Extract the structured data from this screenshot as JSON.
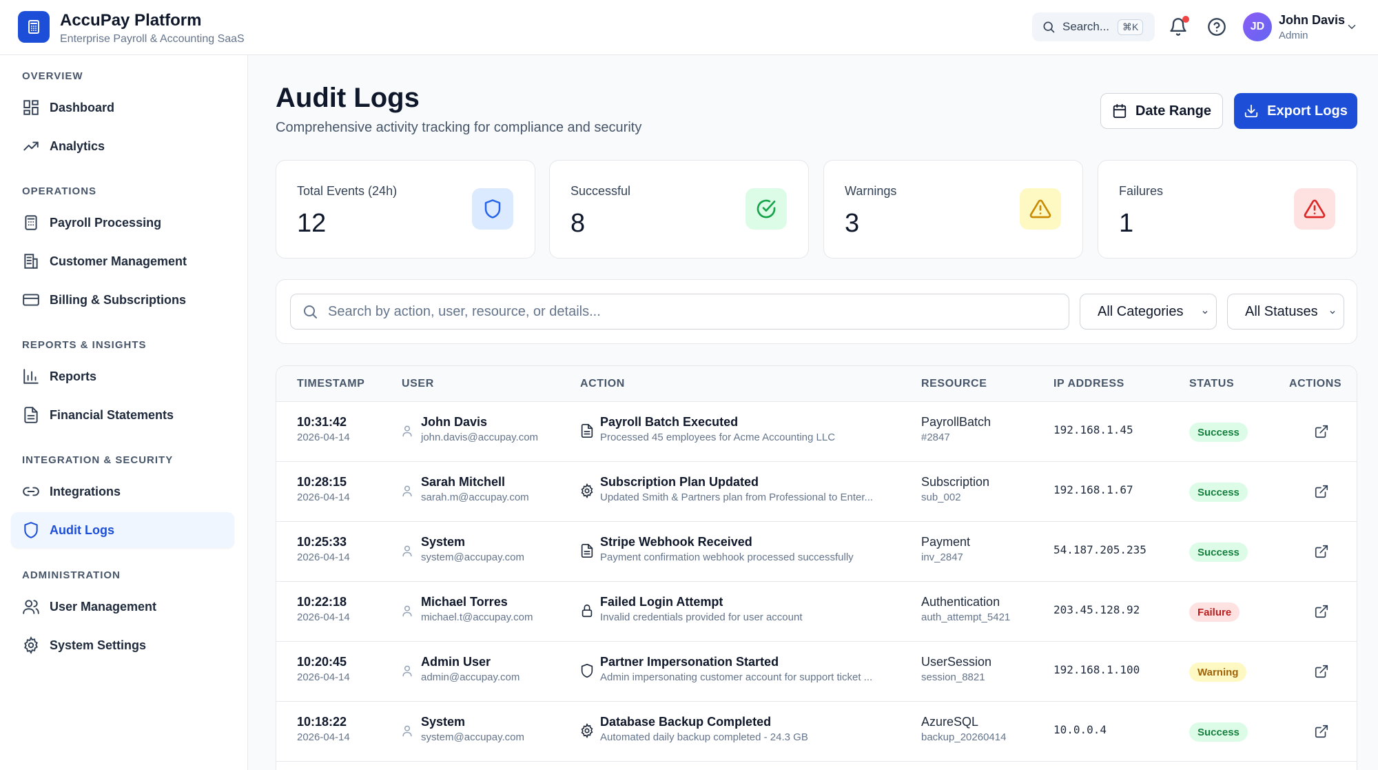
{
  "header": {
    "app_title": "AccuPay Platform",
    "app_subtitle": "Enterprise Payroll & Accounting SaaS",
    "search_label": "Search...",
    "search_shortcut": "⌘K",
    "user_initials": "JD",
    "user_name": "John Davis",
    "user_role": "Admin"
  },
  "sidebar": {
    "sections": [
      {
        "label": "OVERVIEW",
        "items": [
          {
            "label": "Dashboard",
            "icon": "grid-icon"
          },
          {
            "label": "Analytics",
            "icon": "trending-up-icon"
          }
        ]
      },
      {
        "label": "OPERATIONS",
        "items": [
          {
            "label": "Payroll Processing",
            "icon": "calculator-icon"
          },
          {
            "label": "Customer Management",
            "icon": "building-icon"
          },
          {
            "label": "Billing & Subscriptions",
            "icon": "credit-card-icon"
          }
        ]
      },
      {
        "label": "REPORTS & INSIGHTS",
        "items": [
          {
            "label": "Reports",
            "icon": "bar-chart-icon"
          },
          {
            "label": "Financial Statements",
            "icon": "file-text-icon"
          }
        ]
      },
      {
        "label": "INTEGRATION & SECURITY",
        "items": [
          {
            "label": "Integrations",
            "icon": "link-icon"
          },
          {
            "label": "Audit Logs",
            "icon": "shield-icon",
            "active": true
          }
        ]
      },
      {
        "label": "ADMINISTRATION",
        "items": [
          {
            "label": "User Management",
            "icon": "users-icon"
          },
          {
            "label": "System Settings",
            "icon": "gear-icon"
          }
        ]
      }
    ]
  },
  "page": {
    "title": "Audit Logs",
    "subtitle": "Comprehensive activity tracking for compliance and security",
    "date_range_label": "Date Range",
    "export_label": "Export Logs"
  },
  "stats": [
    {
      "label": "Total Events (24h)",
      "value": "12",
      "icon": "shield-icon",
      "color": "#2563eb",
      "bg": "#dbeafe"
    },
    {
      "label": "Successful",
      "value": "8",
      "icon": "check-circle-icon",
      "color": "#16a34a",
      "bg": "#dcfce7"
    },
    {
      "label": "Warnings",
      "value": "3",
      "icon": "warning-icon",
      "color": "#ca8a04",
      "bg": "#fef9c3"
    },
    {
      "label": "Failures",
      "value": "1",
      "icon": "alert-icon",
      "color": "#dc2626",
      "bg": "#fee2e2"
    }
  ],
  "filters": {
    "search_placeholder": "Search by action, user, resource, or details...",
    "category_selected": "All Categories",
    "status_selected": "All Statuses"
  },
  "table": {
    "columns": [
      "TIMESTAMP",
      "USER",
      "ACTION",
      "RESOURCE",
      "IP ADDRESS",
      "STATUS",
      "ACTIONS"
    ],
    "rows": [
      {
        "time": "10:31:42",
        "date": "2026-04-14",
        "user": "John Davis",
        "email": "john.davis@accupay.com",
        "action_icon": "document-icon",
        "action": "Payroll Batch Executed",
        "details": "Processed 45 employees for Acme Accounting LLC",
        "resource": "PayrollBatch",
        "resource_id": "#2847",
        "ip": "192.168.1.45",
        "status": "Success",
        "status_kind": "success"
      },
      {
        "time": "10:28:15",
        "date": "2026-04-14",
        "user": "Sarah Mitchell",
        "email": "sarah.m@accupay.com",
        "action_icon": "gear-icon",
        "action": "Subscription Plan Updated",
        "details": "Updated Smith & Partners plan from Professional to Enter...",
        "resource": "Subscription",
        "resource_id": "sub_002",
        "ip": "192.168.1.67",
        "status": "Success",
        "status_kind": "success"
      },
      {
        "time": "10:25:33",
        "date": "2026-04-14",
        "user": "System",
        "email": "system@accupay.com",
        "action_icon": "document-icon",
        "action": "Stripe Webhook Received",
        "details": "Payment confirmation webhook processed successfully",
        "resource": "Payment",
        "resource_id": "inv_2847",
        "ip": "54.187.205.235",
        "status": "Success",
        "status_kind": "success"
      },
      {
        "time": "10:22:18",
        "date": "2026-04-14",
        "user": "Michael Torres",
        "email": "michael.t@accupay.com",
        "action_icon": "lock-icon",
        "action": "Failed Login Attempt",
        "details": "Invalid credentials provided for user account",
        "resource": "Authentication",
        "resource_id": "auth_attempt_5421",
        "ip": "203.45.128.92",
        "status": "Failure",
        "status_kind": "failure"
      },
      {
        "time": "10:20:45",
        "date": "2026-04-14",
        "user": "Admin User",
        "email": "admin@accupay.com",
        "action_icon": "shield-icon",
        "action": "Partner Impersonation Started",
        "details": "Admin impersonating customer account for support ticket ...",
        "resource": "UserSession",
        "resource_id": "session_8821",
        "ip": "192.168.1.100",
        "status": "Warning",
        "status_kind": "warning"
      },
      {
        "time": "10:18:22",
        "date": "2026-04-14",
        "user": "System",
        "email": "system@accupay.com",
        "action_icon": "gear-icon",
        "action": "Database Backup Completed",
        "details": "Automated daily backup completed - 24.3 GB",
        "resource": "AzureSQL",
        "resource_id": "backup_20260414",
        "ip": "10.0.0.4",
        "status": "Success",
        "status_kind": "success"
      }
    ]
  }
}
